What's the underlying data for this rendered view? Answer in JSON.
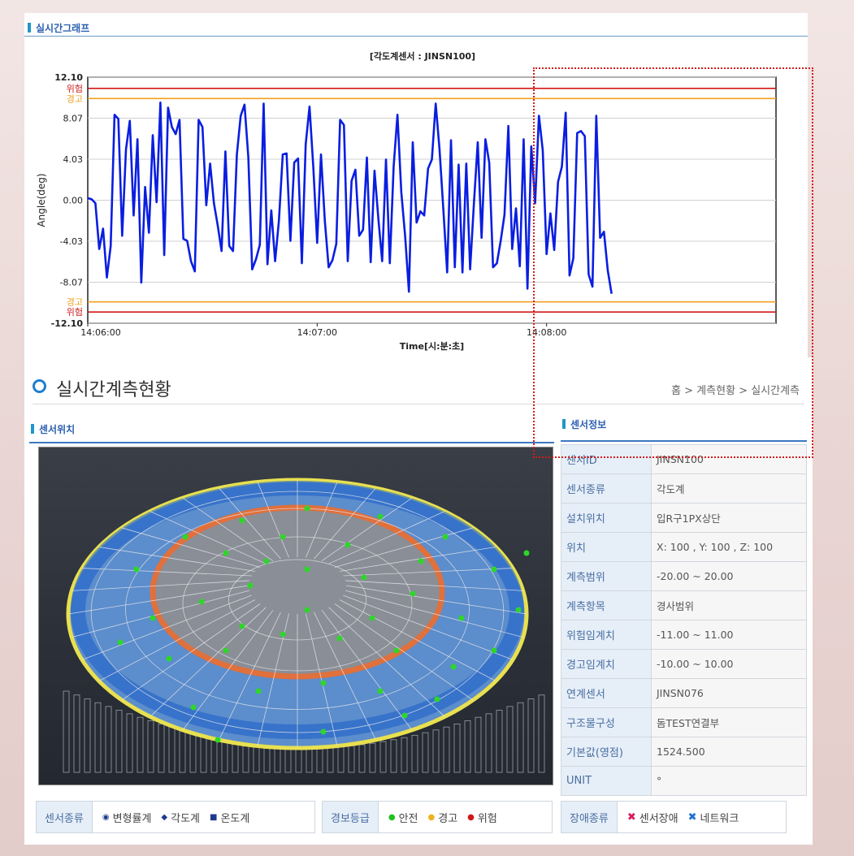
{
  "graph": {
    "section_title": "실시간그래프",
    "chart_title": "[각도계센서 : JINSN100]"
  },
  "chart_data": {
    "type": "line",
    "title": "[각도계센서 : JINSN100]",
    "xlabel": "Time[시:분:초]",
    "ylabel": "Angle(deg)",
    "ylim": [
      -12.1,
      12.1
    ],
    "y_ticks": [
      "12.10",
      "8.07",
      "4.03",
      "0.00",
      "-4.03",
      "-8.07",
      "-12.10"
    ],
    "x_ticks": [
      "14:06:00",
      "14:07:00",
      "14:08:00"
    ],
    "thresholds": [
      {
        "label": "위험",
        "value": 11.0,
        "color": "#d01818"
      },
      {
        "label": "경고",
        "value": 10.0,
        "color": "#f0a020"
      },
      {
        "label": "경고",
        "value": -10.0,
        "color": "#f0a020"
      },
      {
        "label": "위험",
        "value": -11.0,
        "color": "#d01818"
      }
    ],
    "x_seconds": [
      0,
      1,
      2,
      3,
      4,
      5,
      6,
      7,
      8,
      9,
      10,
      11,
      12,
      13,
      14,
      15,
      16,
      17,
      18,
      19,
      20,
      21,
      22,
      23,
      24,
      25,
      26,
      27,
      28,
      29,
      30,
      31,
      32,
      33,
      34,
      35,
      36,
      37,
      38,
      39,
      40,
      41,
      42,
      43,
      44,
      45,
      46,
      47,
      48,
      49,
      50,
      51,
      52,
      53,
      54,
      55,
      56,
      57,
      58,
      59,
      60,
      61,
      62,
      63,
      64,
      65,
      66,
      67,
      68,
      69,
      70,
      71,
      72,
      73,
      74,
      75,
      76,
      77,
      78,
      79,
      80,
      81,
      82,
      83,
      84,
      85,
      86,
      87,
      88,
      89,
      90,
      91,
      92,
      93,
      94,
      95,
      96,
      97,
      98,
      99,
      100,
      101,
      102,
      103,
      104,
      105,
      106,
      107,
      108,
      109,
      110,
      111,
      112,
      113,
      114,
      115,
      116,
      117,
      118,
      119,
      120,
      121,
      122,
      123,
      124,
      125,
      126,
      127,
      128,
      129,
      130,
      131,
      132,
      133,
      134,
      135,
      136,
      137,
      138,
      139,
      140,
      141,
      142,
      143,
      144,
      145,
      146,
      147,
      148,
      149,
      150,
      151,
      152,
      153,
      154,
      155,
      156,
      157,
      158,
      159,
      160,
      161,
      162,
      163,
      164,
      165,
      166,
      167,
      168,
      169,
      170,
      171,
      172,
      173,
      174,
      175,
      176,
      177,
      178,
      179,
      180
    ],
    "series": [
      {
        "color": "#0a1ee0",
        "values": [
          0.2,
          0.1,
          -0.3,
          -4.8,
          -2.8,
          -7.6,
          -4.5,
          8.4,
          8.0,
          -3.5,
          5.0,
          7.8,
          -1.5,
          6.0,
          -8.1,
          1.3,
          -3.2,
          6.4,
          -0.2,
          9.6,
          -5.4,
          9.1,
          7.2,
          6.5,
          7.9,
          -3.8,
          -4.0,
          -6.0,
          -7.0,
          7.9,
          7.2,
          -0.5,
          3.6,
          -0.3,
          -2.5,
          -5.0,
          4.8,
          -4.5,
          -5.0,
          4.5,
          8.3,
          9.4,
          4.2,
          -6.8,
          -5.8,
          -4.4,
          9.5,
          -6.3,
          -1.0,
          -6.0,
          -2.0,
          4.5,
          4.6,
          -4.0,
          3.7,
          4.1,
          -6.2,
          5.5,
          9.2,
          3.2,
          -4.2,
          4.5,
          -2.0,
          -6.6,
          -5.9,
          -4.3,
          7.9,
          7.4,
          -6.0,
          1.9,
          3.0,
          -3.5,
          -2.9,
          4.2,
          -6.1,
          2.9,
          -1.8,
          -6.0,
          4.0,
          -6.2,
          3.3,
          8.4,
          0.8,
          -3.5,
          -9.0,
          5.7,
          -2.2,
          -1.1,
          -1.5,
          3.1,
          4.0,
          9.5,
          5.0,
          -0.9,
          -7.1,
          5.9,
          -6.6,
          3.5,
          -7.1,
          3.6,
          -6.8,
          -0.3,
          5.7,
          -3.7,
          6.0,
          3.7,
          -6.6,
          -6.2,
          -4.0,
          -1.4,
          7.3,
          -4.8,
          -0.8,
          -6.5,
          6.0,
          -8.7,
          5.3,
          -0.3,
          8.3,
          4.9,
          -5.3,
          -1.3,
          -4.9,
          1.8,
          3.3,
          8.6,
          -7.4,
          -5.7,
          6.6,
          6.8,
          6.3,
          -7.3,
          -8.5,
          8.3,
          -3.7,
          -3.1,
          -6.9,
          -9.2
        ]
      }
    ],
    "grid": true
  },
  "page": {
    "heading": "실시간계측현황",
    "breadcrumb": "홈 > 계측현황 > 실시간계측",
    "left_section": "센서위치",
    "right_section": "센서정보"
  },
  "sensor_info": [
    {
      "key": "센서ID",
      "value": "JINSN100"
    },
    {
      "key": "센서종류",
      "value": "각도계"
    },
    {
      "key": "설치위치",
      "value": "입R구1PX상단"
    },
    {
      "key": "위치",
      "value": "X: 100 , Y: 100 , Z: 100"
    },
    {
      "key": "계측범위",
      "value": "-20.00 ~ 20.00"
    },
    {
      "key": "계측항목",
      "value": "경사범위"
    },
    {
      "key": "위험임계치",
      "value": "-11.00 ~ 11.00"
    },
    {
      "key": "경고임계치",
      "value": "-10.00 ~ 10.00"
    },
    {
      "key": "연계센서",
      "value": "JINSN076"
    },
    {
      "key": "구조물구성",
      "value": "돔TEST연결부"
    },
    {
      "key": "기본값(영점)",
      "value": "1524.500"
    },
    {
      "key": "UNIT",
      "value": "°"
    }
  ],
  "legends": {
    "sensor_type": {
      "label": "센서종류",
      "items": [
        "변형률계",
        "각도계",
        "온도계"
      ],
      "colors": [
        "#1c3a8c",
        "#1c3a8c",
        "#1c3a8c"
      ]
    },
    "alarm_level": {
      "label": "경보등급",
      "items": [
        "안전",
        "경고",
        "위험"
      ],
      "colors": [
        "#22c020",
        "#f0b020",
        "#d01818"
      ]
    },
    "fault_type": {
      "label": "장애종류",
      "items": [
        "센서장애",
        "네트워크"
      ],
      "colors": [
        "#d81b60",
        "#1e6fd0"
      ]
    }
  }
}
